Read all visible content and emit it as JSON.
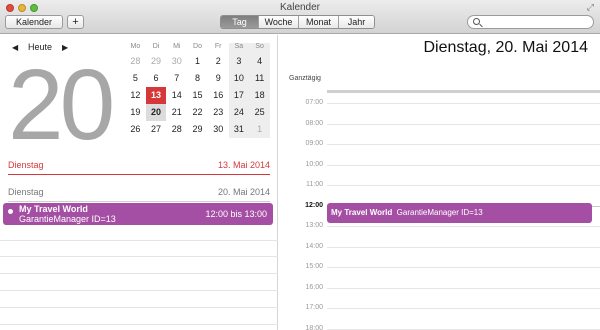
{
  "window": {
    "title": "Kalender"
  },
  "toolbar": {
    "calendars_label": "Kalender",
    "add_label": "+",
    "views": [
      "Tag",
      "Woche",
      "Monat",
      "Jahr"
    ],
    "active_view": "Tag",
    "search_placeholder": ""
  },
  "mini_calendar": {
    "nav_today": "Heute",
    "big_day": "20",
    "weekdays": [
      "Mo",
      "Di",
      "Mi",
      "Do",
      "Fr",
      "Sa",
      "So"
    ],
    "weeks": [
      [
        "28",
        "29",
        "30",
        "1",
        "2",
        "3",
        "4"
      ],
      [
        "5",
        "6",
        "7",
        "8",
        "9",
        "10",
        "11"
      ],
      [
        "12",
        "13",
        "14",
        "15",
        "16",
        "17",
        "18"
      ],
      [
        "19",
        "20",
        "21",
        "22",
        "23",
        "24",
        "25"
      ],
      [
        "26",
        "27",
        "28",
        "29",
        "30",
        "31",
        "1"
      ]
    ],
    "today": "13",
    "selected": "20"
  },
  "sections": {
    "today": {
      "day": "Dienstag",
      "date": "13. Mai 2014"
    },
    "selected": {
      "day": "Dienstag",
      "date": "20. Mai 2014"
    }
  },
  "event": {
    "title": "My Travel World",
    "subtitle": "GarantieManager ID=13",
    "time": "12:00 bis 13:00",
    "color": "#a54fa4"
  },
  "day_view": {
    "title": "Dienstag, 20. Mai 2014",
    "allday_label": "Ganztägig",
    "hours": [
      "07:00",
      "08:00",
      "09:00",
      "10:00",
      "11:00",
      "12:00",
      "13:00",
      "14:00",
      "15:00",
      "16:00",
      "17:00",
      "18:00"
    ],
    "current_hour": "12:00"
  },
  "colors": {
    "today_accent": "#d6383a",
    "event": "#a54fa4"
  }
}
